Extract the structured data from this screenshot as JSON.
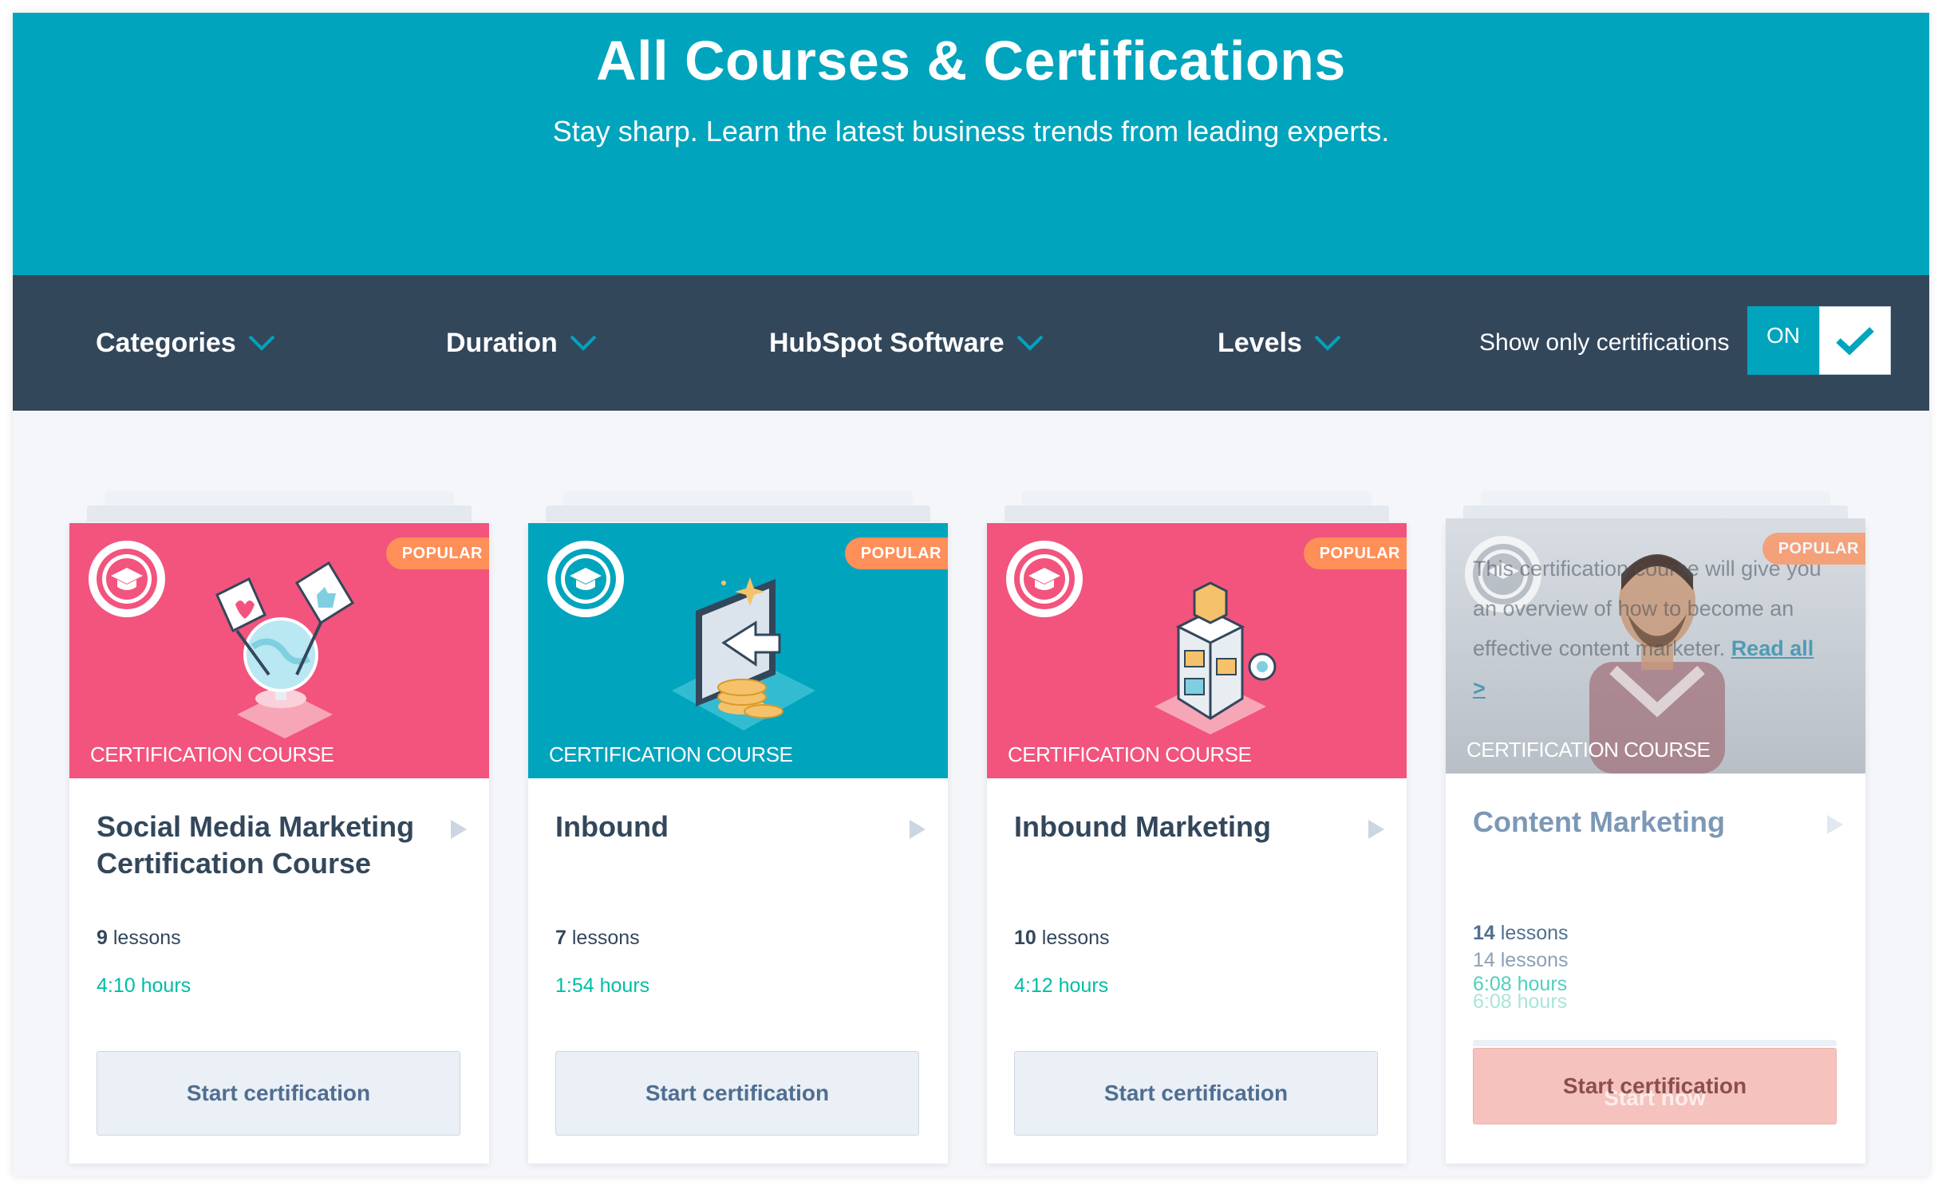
{
  "hero": {
    "title": "All Courses & Certifications",
    "subtitle": "Stay sharp. Learn the latest business trends from leading experts."
  },
  "filters": {
    "categories": "Categories",
    "duration": "Duration",
    "software": "HubSpot Software",
    "levels": "Levels",
    "toggle_label": "Show only certifications",
    "toggle_state": "ON"
  },
  "colors": {
    "hero": "#00a4bd",
    "filter_bar": "#33475b",
    "pink": "#f2547d",
    "teal": "#00a4bd",
    "popular": "#ff8f59",
    "hours": "#00bda5"
  },
  "cards": [
    {
      "badge": "POPULAR",
      "type": "CERTIFICATION COURSE",
      "title": "Social Media Marketing Certification Course",
      "lessons_count": "9",
      "lessons_word": "lessons",
      "hours": "4:10 hours",
      "button": "Start certification",
      "illustration": "globe-with-flags-icon",
      "color": "pink"
    },
    {
      "badge": "POPULAR",
      "type": "CERTIFICATION COURSE",
      "title": "Inbound",
      "lessons_count": "7",
      "lessons_word": "lessons",
      "hours": "1:54 hours",
      "button": "Start certification",
      "illustration": "magnet-screen-coins-icon",
      "color": "teal"
    },
    {
      "badge": "POPULAR",
      "type": "CERTIFICATION COURSE",
      "title": "Inbound Marketing",
      "lessons_count": "10",
      "lessons_word": "lessons",
      "hours": "4:12 hours",
      "button": "Start certification",
      "illustration": "building-blocks-icon",
      "color": "pink"
    },
    {
      "badge": "POPULAR",
      "type": "CERTIFICATION COURSE",
      "title": "Content Marketing",
      "description": "This certification course will give you an overview of how to become an effective content marketer.",
      "read_all": "Read all >",
      "lessons_count": "14",
      "lessons_word": "lessons",
      "lessons_ghost": "14 lessons",
      "hours": "6:08 hours",
      "hours_ghost": "6:08 hours",
      "button": "Start certification",
      "button_ghost": "Start now",
      "illustration": "instructor-photo"
    }
  ]
}
